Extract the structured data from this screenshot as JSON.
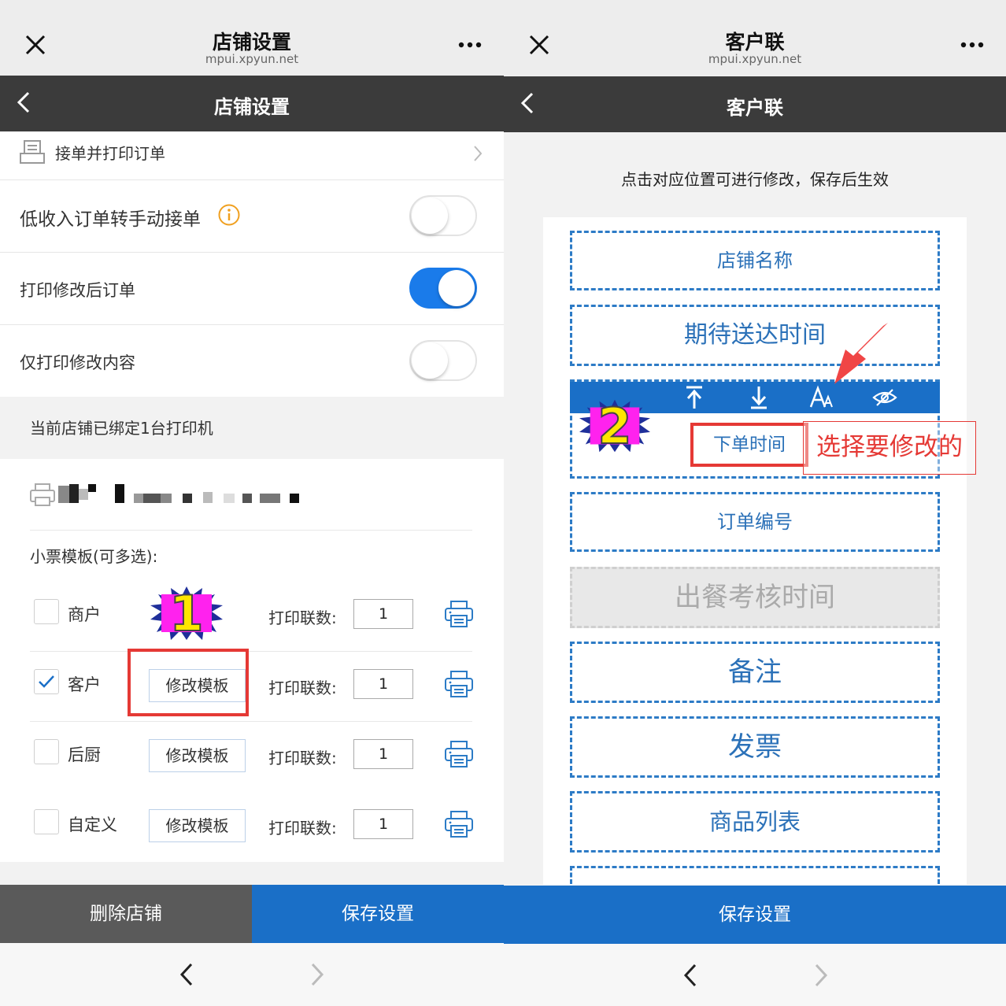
{
  "left": {
    "topbar": {
      "title": "店铺设置",
      "subtitle": "mpui.xpyun.net"
    },
    "header": {
      "title": "店铺设置"
    },
    "rows": {
      "receive_print": "接单并打印订单",
      "low_income": "低收入订单转手动接单",
      "print_modified": "打印修改后订单",
      "print_modified_only": "仅打印修改内容"
    },
    "toggles": {
      "low_income": false,
      "print_modified": true,
      "print_modified_only": false
    },
    "bound_printer_text": "当前店铺已绑定1台打印机",
    "template_section_label": "小票模板(可多选):",
    "step_badge": "1",
    "templates": [
      {
        "name": "商户",
        "checked": false,
        "edit_label": "",
        "copies_label": "打印联数:",
        "copies": "1"
      },
      {
        "name": "客户",
        "checked": true,
        "edit_label": "修改模板",
        "copies_label": "打印联数:",
        "copies": "1"
      },
      {
        "name": "后厨",
        "checked": false,
        "edit_label": "修改模板",
        "copies_label": "打印联数:",
        "copies": "1"
      },
      {
        "name": "自定义",
        "checked": false,
        "edit_label": "修改模板",
        "copies_label": "打印联数:",
        "copies": "1"
      }
    ],
    "delete_button": "删除店铺",
    "save_button": "保存设置",
    "colors": {
      "accent": "#1a6fc7",
      "delete": "#5a5a5a",
      "highlight": "#e53935"
    }
  },
  "right": {
    "topbar": {
      "title": "客户联",
      "subtitle": "mpui.xpyun.net"
    },
    "header": {
      "title": "客户联"
    },
    "instruction": "点击对应位置可进行修改，保存后生效",
    "step_badge": "2",
    "fields": {
      "store_name": "店铺名称",
      "expected_delivery": "期待送达时间",
      "order_time": "下单时间",
      "order_number": "订单编号",
      "meal_check_time": "出餐考核时间",
      "remark": "备注",
      "invoice": "发票",
      "product_list": "商品列表"
    },
    "annotation": "选择要修改的",
    "save_button": "保存设置",
    "toolbar_icons": [
      "move-top-icon",
      "move-down-icon",
      "font-size-icon",
      "hide-eye-icon"
    ]
  }
}
